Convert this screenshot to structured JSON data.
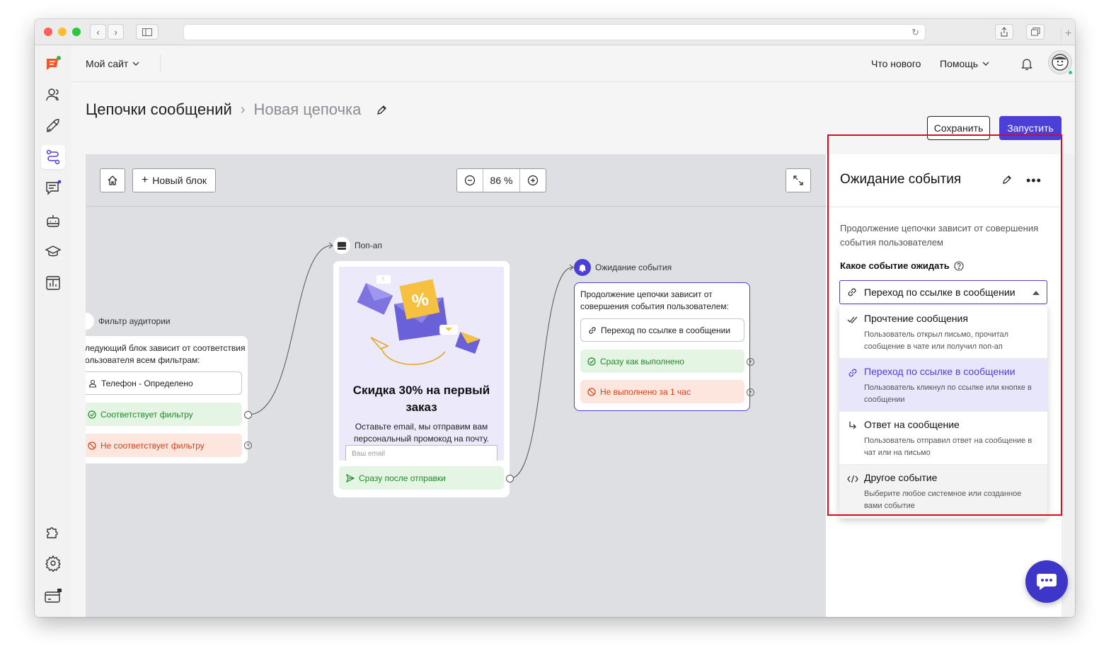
{
  "topbar": {
    "site_label": "Мой сайт",
    "whats_new": "Что нового",
    "help": "Помощь"
  },
  "breadcrumb": {
    "root": "Цепочки сообщений",
    "current": "Новая цепочка"
  },
  "actions": {
    "save": "Сохранить",
    "run": "Запустить"
  },
  "canvas_toolbar": {
    "new_block": "Новый блок",
    "zoom": "86 %"
  },
  "filter_node": {
    "label": "Фильтр аудитории",
    "description": "ледующий блок зависит от соответствия ользователя всем фильтрам:",
    "condition": "Телефон - Определено",
    "match": "Соответствует фильтру",
    "no_match": "Не соответствует фильтру"
  },
  "popup_node": {
    "label": "Поп-ап",
    "title": "Скидка 30% на первый заказ",
    "text": "Оставьте email, мы отправим вам персональный промокод на почту.",
    "email_placeholder": "Ваш email",
    "after_send": "Сразу после отправки"
  },
  "wait_node": {
    "label": "Ожидание события",
    "description": "Продолжение цепочки зависит от совершения события пользователем:",
    "event": "Переход по ссылке в сообщении",
    "done": "Сразу как выполнено",
    "not_done": "Не выполнено за 1 час"
  },
  "panel": {
    "title": "Ожидание события",
    "description": "Продолжение цепочки зависит от совершения события пользователем",
    "question": "Какое событие ожидать",
    "selected": "Переход по ссылке в сообщении",
    "options": [
      {
        "title": "Прочтение сообщения",
        "desc": "Пользователь открыл письмо, прочитал сообщение в чате или получил поп-ап",
        "icon": "double-check-icon"
      },
      {
        "title": "Переход по ссылке в сообщении",
        "desc": "Пользователь кликнул по ссылке или кнопке в сообщении",
        "icon": "link-icon"
      },
      {
        "title": "Ответ на сообщение",
        "desc": "Пользователь отправил ответ на сообщение в чат или на письмо",
        "icon": "reply-arrow-icon"
      },
      {
        "title": "Другое событие",
        "desc": "Выберите любое системное или созданное вами событие",
        "icon": "code-icon"
      }
    ]
  },
  "colors": {
    "accent": "#4b3fd8",
    "success_bg": "#e5f5e3",
    "success_text": "#1f8a2b",
    "error_bg": "#fde6dd",
    "error_text": "#d2421c",
    "highlight": "#e0081b"
  }
}
